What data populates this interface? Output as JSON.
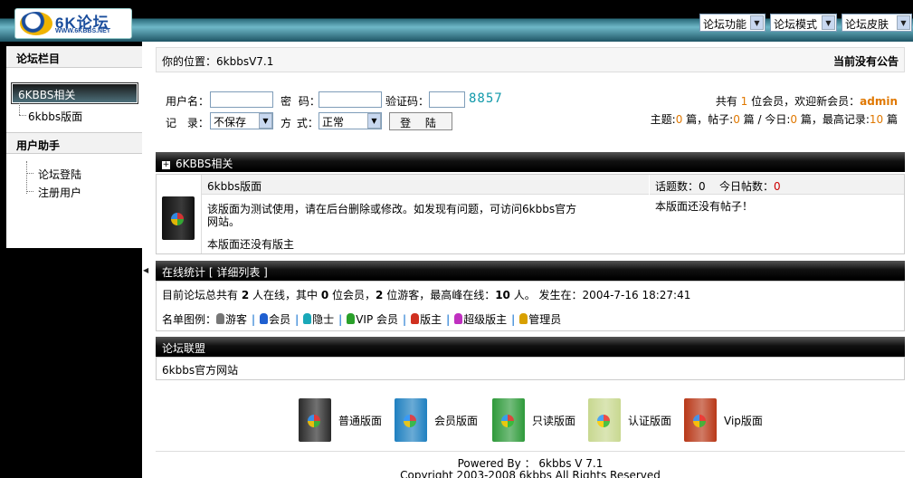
{
  "header": {
    "logo_text": "6K论坛",
    "logo_sub": "WWW.6KBBS.NET",
    "menus": [
      "论坛功能",
      "论坛模式",
      "论坛皮肤"
    ]
  },
  "sidebar": {
    "section1_title": "论坛栏目",
    "category": "6KBBS相关",
    "board": "6kbbs版面",
    "section2_title": "用户助手",
    "help_items": [
      "论坛登陆",
      "注册用户"
    ]
  },
  "location": {
    "text": "你的位置：6kbbsV7.1",
    "announcement": "当前没有公告"
  },
  "login": {
    "username_label": "用户名：",
    "password_label": "密 码：",
    "captcha_label": "验证码：",
    "captcha_value": "8857",
    "remember_label": "记 录：",
    "remember_value": "不保存",
    "mode_label": "方 式：",
    "mode_value": "正常",
    "submit": "登 陆"
  },
  "stats": {
    "members_pre": "共有 ",
    "members_count": "1",
    "members_post": " 位会员，欢迎新会员：",
    "newest_member": "admin",
    "topics_label": "主题:",
    "topics": "0",
    "posts_label": " 篇，帖子:",
    "posts": "0",
    "today_label": " 篇 / 今日:",
    "today": "0",
    "record_label": " 篇，最高记录:",
    "record": "10",
    "record_unit": " 篇"
  },
  "category_section": {
    "title": "6KBBS相关",
    "board_name": "6kbbs版面",
    "topics_label": "话题数：",
    "topics": "0",
    "today_label": "今日帖数：",
    "today": "0",
    "description_line1": "该版面为测试使用，请在后台删除或修改。如发现有问题，可访问6kbbs官方",
    "description_line2": "网站。",
    "moderator": "本版面还没有版主",
    "last_post": "本版面还没有帖子！"
  },
  "online": {
    "title": "在线统计",
    "detail_link": "[ 详细列表 ]",
    "summary_pre": "目前论坛总共有 ",
    "total": "2",
    "summary_mid1": " 人在线，其中 ",
    "members": "0",
    "summary_mid2": " 位会员，",
    "guests": "2",
    "summary_mid3": " 位游客，最高峰在线：",
    "peak": "10",
    "summary_mid4": " 人。 发生在：",
    "peak_time": "2004-7-16 18:27:41",
    "legend_label": "名单图例：",
    "legend": [
      {
        "label": "游客",
        "color": "#777777"
      },
      {
        "label": "会员",
        "color": "#1f5fd0"
      },
      {
        "label": "隐士",
        "color": "#19a8b8"
      },
      {
        "label": "VIP 会员",
        "color": "#2aa02a"
      },
      {
        "label": "版主",
        "color": "#d03020"
      },
      {
        "label": "超级版主",
        "color": "#c030c0"
      },
      {
        "label": "管理员",
        "color": "#d8a000"
      }
    ]
  },
  "alliance": {
    "title": "论坛联盟",
    "link": "6kbbs官方网站"
  },
  "board_types": [
    {
      "label": "普通版面",
      "color": "#2a2a2a"
    },
    {
      "label": "会员版面",
      "color": "#1f80c0"
    },
    {
      "label": "只读版面",
      "color": "#2e9a3a"
    },
    {
      "label": "认证版面",
      "color": "#c8d890"
    },
    {
      "label": "Vip版面",
      "color": "#b83818"
    }
  ],
  "footer": {
    "powered": "Powered By ：  6kbbs V 7.1",
    "copyright": "Copyright 2003-2008 6kbbs All Rights Reserved"
  }
}
